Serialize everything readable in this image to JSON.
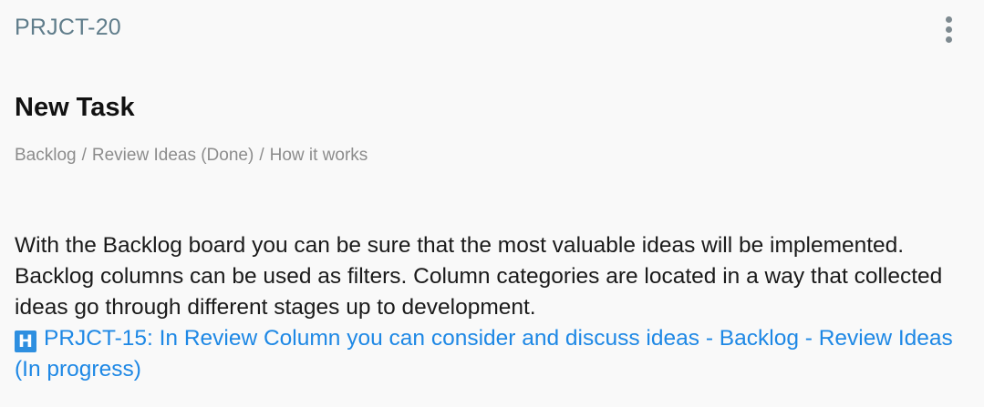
{
  "task": {
    "id": "PRJCT-20",
    "title": "New Task"
  },
  "breadcrumb": {
    "items": [
      "Backlog",
      "Review Ideas (Done)",
      "How it works"
    ],
    "separator": "/"
  },
  "description": {
    "text": "With the Backlog board you can be sure that the most valuable ideas will be implemented. Backlog columns can be used as filters. Column categories are located in a way that collected ideas go through different stages up to development.",
    "linked_task": {
      "icon_letter": "H",
      "label": "PRJCT-15: In Review Column you can consider and discuss ideas - Backlog - Review Ideas (In progress)"
    }
  },
  "icons": {
    "more_menu": "more-vertical-icon",
    "linked_task": "h-badge-icon"
  },
  "colors": {
    "task_id": "#607d8b",
    "link": "#1e88e5",
    "breadcrumb": "#8c8c8c",
    "h_badge": "#2e8fe0",
    "background": "#f9f9f9"
  }
}
